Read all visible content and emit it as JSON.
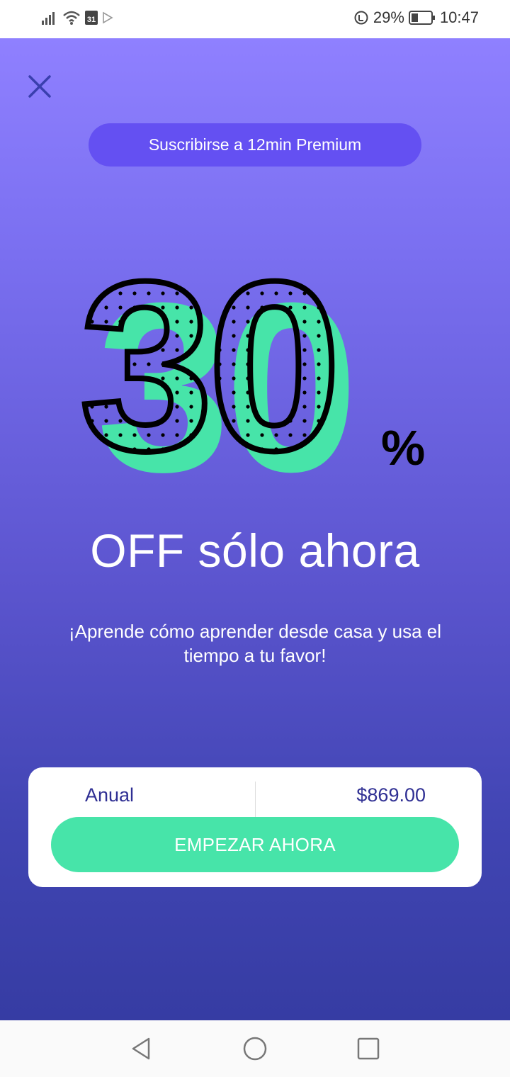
{
  "status_bar": {
    "calendar_day": "31",
    "battery": "29%",
    "time": "10:47",
    "icons": [
      "signal-icon",
      "wifi-icon",
      "calendar-icon",
      "play-icon",
      "data-saver-icon",
      "battery-icon"
    ]
  },
  "header": {
    "close_icon": "close-icon",
    "subscribe_label": "Suscribirse a 12min Premium"
  },
  "promo": {
    "discount_number": "30",
    "percent_sign": "%",
    "headline": "OFF sólo ahora",
    "subtitle": "¡Aprende cómo aprender desde casa y usa el tiempo a tu favor!"
  },
  "plan": {
    "name": "Anual",
    "price": "$869.00",
    "cta_label": "EMPEZAR AHORA"
  },
  "nav_bar": {
    "icons": [
      "back-icon",
      "home-icon",
      "recents-icon"
    ]
  },
  "colors": {
    "accent_green": "#47e4a9",
    "pill_purple": "#6450f2",
    "plan_text": "#2f2f93",
    "gradient_top": "#8f80ff",
    "gradient_bottom": "#363ca3"
  }
}
